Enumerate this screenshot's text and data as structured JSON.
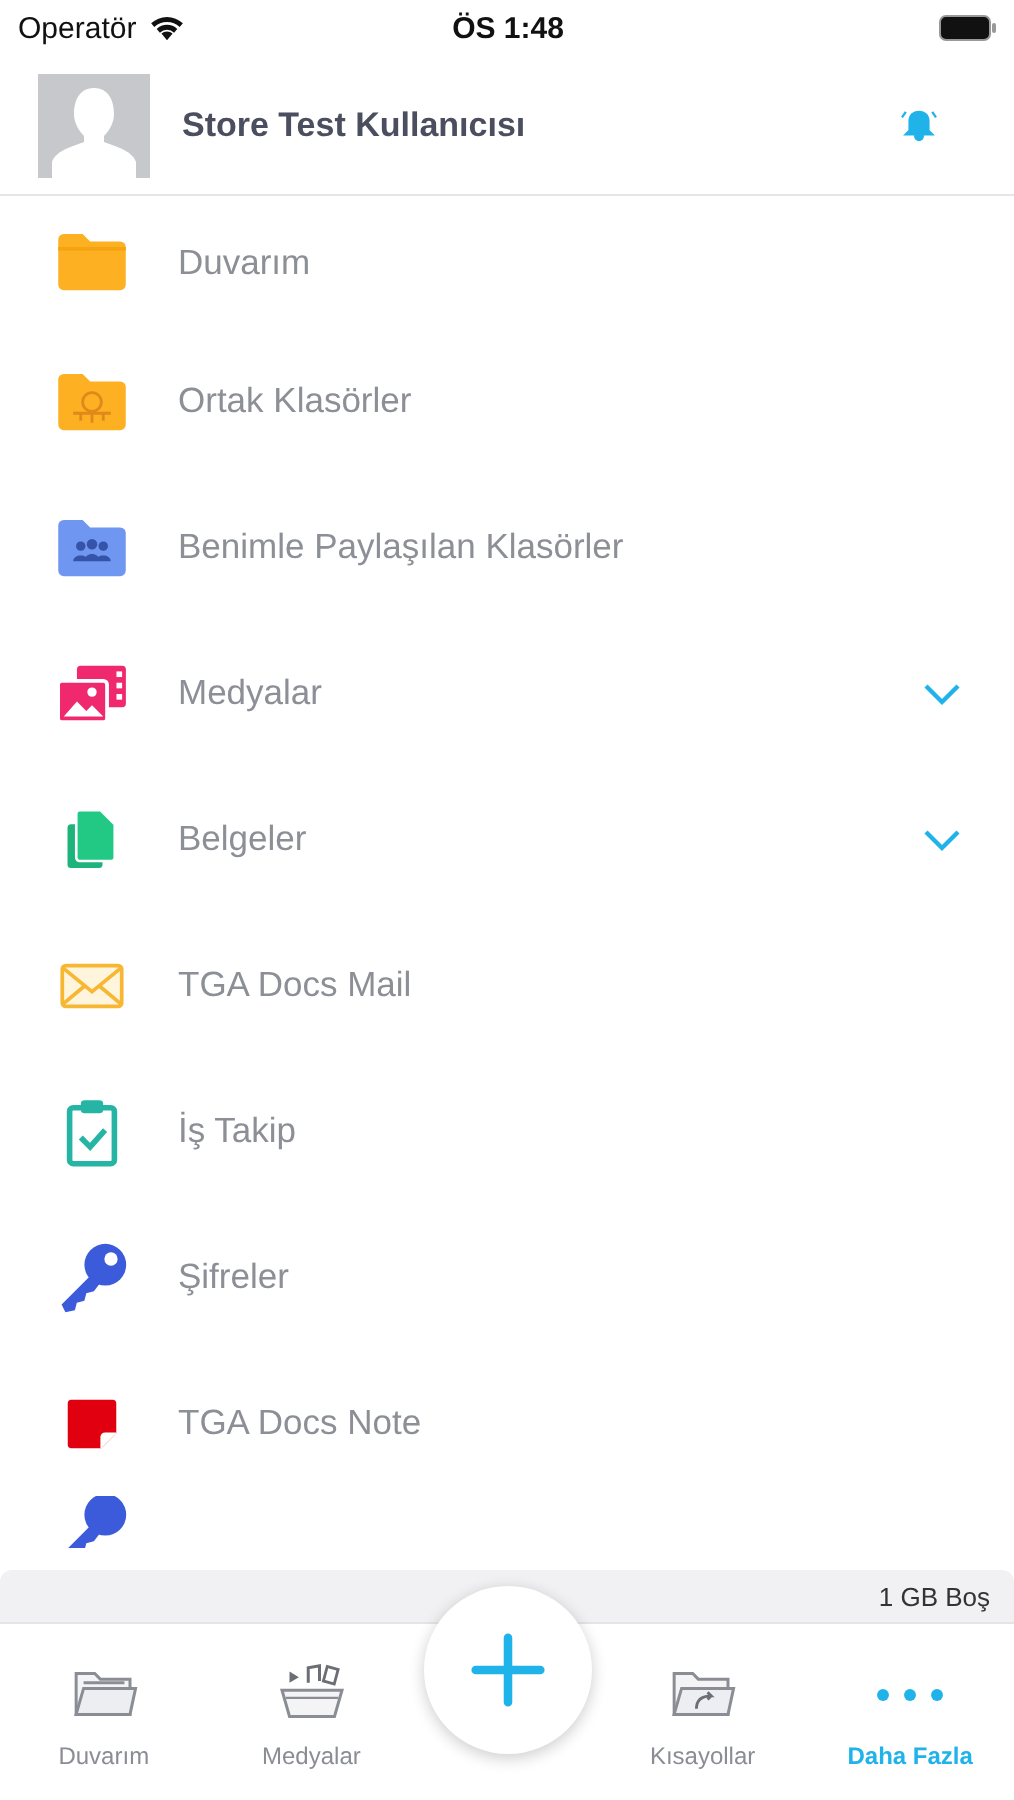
{
  "status_bar": {
    "carrier": "Operatör",
    "time": "ÖS 1:48"
  },
  "header": {
    "user_name": "Store Test Kullanıcısı"
  },
  "menu_items": [
    {
      "kind": "folder",
      "label": "Duvarım",
      "expandable": false
    },
    {
      "kind": "shared-folder",
      "label": "Ortak Klasörler",
      "expandable": false
    },
    {
      "kind": "group-folder",
      "label": "Benimle Paylaşılan Klasörler",
      "expandable": false
    },
    {
      "kind": "media",
      "label": "Medyalar",
      "expandable": true
    },
    {
      "kind": "documents",
      "label": "Belgeler",
      "expandable": true
    },
    {
      "kind": "mail",
      "label": "TGA Docs Mail",
      "expandable": false
    },
    {
      "kind": "clipboard",
      "label": "İş Takip",
      "expandable": false
    },
    {
      "kind": "key",
      "label": "Şifreler",
      "expandable": false
    },
    {
      "kind": "note",
      "label": "TGA Docs Note",
      "expandable": false
    },
    {
      "kind": "partial"
    }
  ],
  "storage": {
    "free_space": "1 GB Boş"
  },
  "tabs": [
    {
      "kind": "folder",
      "label": "Duvarım",
      "selected": false
    },
    {
      "kind": "media",
      "label": "Medyalar",
      "selected": false
    },
    {
      "kind": "add",
      "selected": false
    },
    {
      "kind": "shortcut",
      "label": "Kısayollar",
      "selected": false
    },
    {
      "kind": "more",
      "label": "Daha Fazla",
      "selected": true
    }
  ]
}
